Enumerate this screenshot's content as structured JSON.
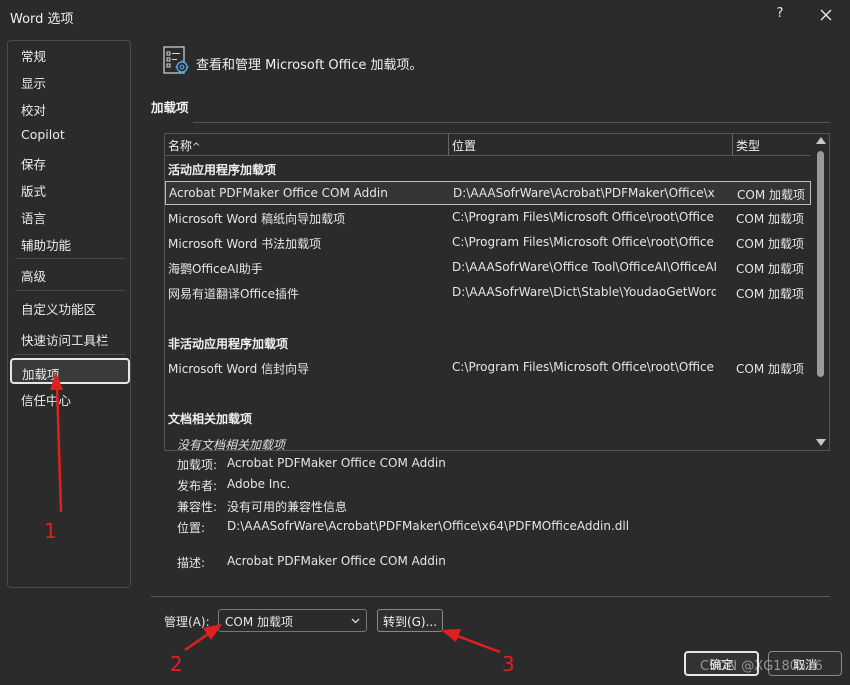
{
  "window": {
    "title": "Word 选项",
    "help_label": "?",
    "close_icon": "close-icon"
  },
  "sidebar": {
    "items": [
      {
        "label": "常规"
      },
      {
        "label": "显示"
      },
      {
        "label": "校对"
      },
      {
        "label": "Copilot"
      },
      {
        "label": "保存"
      },
      {
        "label": "版式"
      },
      {
        "label": "语言"
      },
      {
        "label": "辅助功能"
      },
      {
        "label": "高级"
      },
      {
        "label": "自定义功能区"
      },
      {
        "label": "快速访问工具栏"
      },
      {
        "label": "加载项",
        "selected": true
      },
      {
        "label": "信任中心"
      }
    ]
  },
  "main": {
    "header_text": "查看和管理 Microsoft Office 加载项。",
    "header_icon": "addins-gear-icon",
    "section_title": "加载项",
    "table": {
      "columns": [
        "名称",
        "位置",
        "类型"
      ],
      "sort_indicator": "^",
      "groups": [
        {
          "label": "活动应用程序加载项",
          "rows": [
            {
              "name": "Acrobat PDFMaker Office COM Addin",
              "location": "D:\\AAASofrWare\\Acrobat\\PDFMaker\\Office\\x",
              "type": "COM 加载项",
              "selected": true
            },
            {
              "name": "Microsoft Word 稿纸向导加载项",
              "location": "C:\\Program Files\\Microsoft Office\\root\\Office",
              "type": "COM 加载项"
            },
            {
              "name": "Microsoft Word 书法加载项",
              "location": "C:\\Program Files\\Microsoft Office\\root\\Office",
              "type": "COM 加载项"
            },
            {
              "name": "海鹦OfficeAI助手",
              "location": "D:\\AAASofrWare\\Office Tool\\OfficeAI\\OfficeAI",
              "type": "COM 加载项"
            },
            {
              "name": "网易有道翻译Office插件",
              "location": "D:\\AAASofrWare\\Dict\\Stable\\YoudaoGetWord",
              "type": "COM 加载项"
            }
          ]
        },
        {
          "label": "非活动应用程序加载项",
          "rows": [
            {
              "name": "Microsoft Word 信封向导",
              "location": "C:\\Program Files\\Microsoft Office\\root\\Office",
              "type": "COM 加载项"
            }
          ]
        },
        {
          "label": "文档相关加载项",
          "rows": []
        }
      ],
      "empty_note": "没有文档相关加载项"
    },
    "details": {
      "addin": {
        "label": "加载项:",
        "value": "Acrobat PDFMaker Office COM Addin"
      },
      "publisher": {
        "label": "发布者:",
        "value": "Adobe Inc."
      },
      "compat": {
        "label": "兼容性:",
        "value": "没有可用的兼容性信息"
      },
      "location": {
        "label": "位置:",
        "value": "D:\\AAASofrWare\\Acrobat\\PDFMaker\\Office\\x64\\PDFMOfficeAddin.dll"
      },
      "description": {
        "label": "描述:",
        "value": "Acrobat PDFMaker Office COM Addin"
      }
    },
    "manage": {
      "label": "管理(A):",
      "selected_value": "COM 加载项",
      "goto_label": "转到(G)..."
    }
  },
  "footer": {
    "ok_label": "确定",
    "cancel_label": "取消"
  },
  "annotations": {
    "marker_1": "1",
    "marker_2": "2",
    "marker_3": "3",
    "arrow_color": "#e02020"
  },
  "watermark": "CSDN @XG180516",
  "colors": {
    "background": "#2b2b2b",
    "border": "#555555",
    "text": "#e8e8e8"
  }
}
